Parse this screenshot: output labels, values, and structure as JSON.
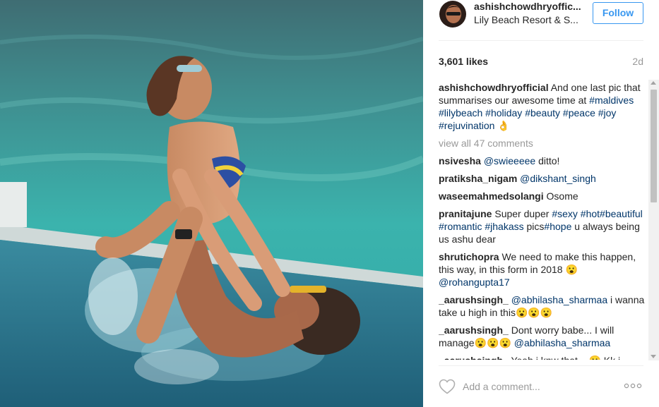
{
  "post": {
    "owner": "ashishchowdhryoffic...",
    "location": "Lily Beach Resort & S...",
    "follow_label": "Follow",
    "likes": "3,601 likes",
    "time_ago": "2d"
  },
  "caption": {
    "user": "ashishchowdhryofficial",
    "text": "And one last pic that summarises our awesome time at",
    "tags": [
      "#maldives",
      "#lilybeach",
      "#holiday",
      "#beauty",
      "#peace",
      "#joy",
      "#rejuvination"
    ],
    "emoji": "👌"
  },
  "view_all_label": "view all 47 comments",
  "comments": [
    {
      "user": "nsivesha",
      "parts": [
        {
          "t": "mention",
          "v": "@swieeeee"
        },
        {
          "t": "text",
          "v": " ditto!"
        }
      ]
    },
    {
      "user": "pratiksha_nigam",
      "parts": [
        {
          "t": "mention",
          "v": "@dikshant_singh"
        }
      ]
    },
    {
      "user": "waseemahmedsolangi",
      "parts": [
        {
          "t": "text",
          "v": "Osome"
        }
      ]
    },
    {
      "user": "pranitajune",
      "parts": [
        {
          "t": "text",
          "v": "Super duper "
        },
        {
          "t": "tag",
          "v": "#sexy"
        },
        {
          "t": "text",
          "v": " "
        },
        {
          "t": "tag",
          "v": "#hot"
        },
        {
          "t": "tag",
          "v": "#beautiful"
        },
        {
          "t": "text",
          "v": " "
        },
        {
          "t": "tag",
          "v": "#romantic"
        },
        {
          "t": "text",
          "v": " "
        },
        {
          "t": "tag",
          "v": "#jhakass"
        },
        {
          "t": "text",
          "v": " pics"
        },
        {
          "t": "tag",
          "v": "#hope"
        },
        {
          "t": "text",
          "v": " u always being us ashu dear"
        }
      ]
    },
    {
      "user": "shrutichopra",
      "parts": [
        {
          "t": "text",
          "v": "We need to make this happen, this way, in this form in 2018 😮 "
        },
        {
          "t": "mention",
          "v": "@rohangupta17"
        }
      ]
    },
    {
      "user": "_aarushsingh_",
      "parts": [
        {
          "t": "mention",
          "v": "@abhilasha_sharmaa"
        },
        {
          "t": "text",
          "v": " i wanna take u high in this😮😮😮"
        }
      ]
    },
    {
      "user": "_aarushsingh_",
      "parts": [
        {
          "t": "text",
          "v": "Dont worry babe... I will manage😮😮😮 "
        },
        {
          "t": "mention",
          "v": "@abhilasha_sharmaa"
        }
      ]
    },
    {
      "user": "_aarushsingh_",
      "parts": [
        {
          "t": "text",
          "v": "Yeah i knw that... 😮 Kk i"
        }
      ]
    }
  ],
  "footer": {
    "comment_placeholder": "Add a comment...",
    "heart_icon": "heart-outline-icon",
    "more_icon": "more-options-icon"
  },
  "colors": {
    "link": "#003569",
    "follow": "#3897f0",
    "muted": "#999999"
  }
}
